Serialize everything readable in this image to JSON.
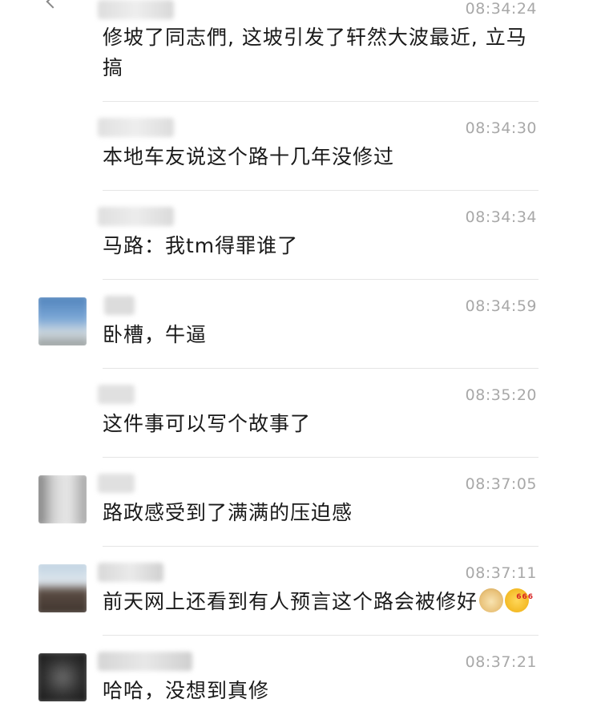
{
  "messages": [
    {
      "time": "08:34:24",
      "text": "修坡了同志們, 这坡引发了轩然大波最近, 立马搞"
    },
    {
      "time": "08:34:30",
      "text": "本地车友说这个路十几年没修过"
    },
    {
      "time": "08:34:34",
      "text": "马路：我tm得罪谁了"
    },
    {
      "time": "08:34:59",
      "text": "卧槽，牛逼"
    },
    {
      "time": "08:35:20",
      "text": "这件事可以写个故事了"
    },
    {
      "time": "08:37:05",
      "text": "路政感受到了满满的压迫感"
    },
    {
      "time": "08:37:11",
      "text": "前天网上还看到有人预言这个路会被修好",
      "emojis": [
        "doge-icon",
        "666-icon"
      ]
    },
    {
      "time": "08:37:21",
      "text": "哈哈，没想到真修"
    }
  ],
  "colors": {
    "background": "#ffffff",
    "text": "#1a1a1a",
    "timestamp": "#a8a8a8",
    "divider": "#e5e5e5"
  }
}
